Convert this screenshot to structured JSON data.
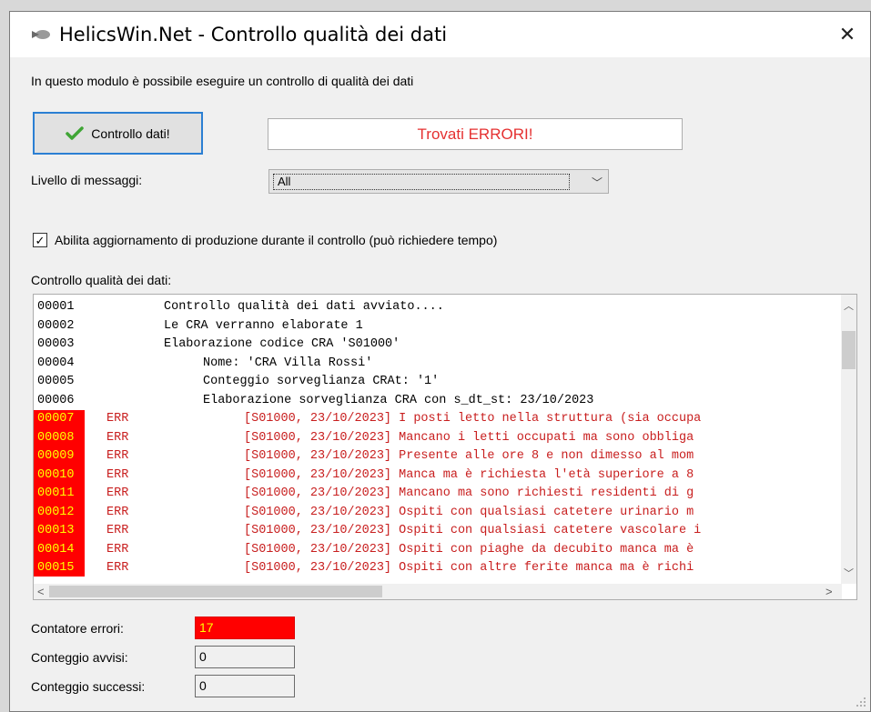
{
  "window": {
    "title": "HelicsWin.Net - Controllo qualità dei dati",
    "close_glyph": "✕"
  },
  "intro": "In questo modulo è possibile eseguire un controllo di qualità dei dati",
  "check_button": {
    "label": "Controllo dati!",
    "icon": "checkmark-icon"
  },
  "result_text": "Trovati ERRORI!",
  "message_level": {
    "label": "Livello di messaggi:",
    "value": "All"
  },
  "production_update": {
    "label": "Abilita aggiornamento di produzione durante il controllo (può richiedere tempo)",
    "checked": true
  },
  "log": {
    "label": "Controllo qualità dei dati:",
    "rows": [
      {
        "num": "00001",
        "level": "",
        "text": "Controllo qualità dei dati avviato....",
        "indent": 0
      },
      {
        "num": "00002",
        "level": "",
        "text": "Le CRA verranno elaborate 1",
        "indent": 0
      },
      {
        "num": "00003",
        "level": "",
        "text": "Elaborazione codice CRA 'S01000'",
        "indent": 0
      },
      {
        "num": "00004",
        "level": "",
        "text": "Nome: 'CRA Villa Rossi'",
        "indent": 1
      },
      {
        "num": "00005",
        "level": "",
        "text": "Conteggio sorveglianza CRAt: '1'",
        "indent": 1
      },
      {
        "num": "00006",
        "level": "",
        "text": "Elaborazione sorveglianza CRA con s_dt_st: 23/10/2023",
        "indent": 1
      },
      {
        "num": "00007",
        "level": "ERR",
        "text": "[S01000, 23/10/2023] I posti letto nella struttura (sia occupa",
        "indent": 2
      },
      {
        "num": "00008",
        "level": "ERR",
        "text": "[S01000, 23/10/2023] Mancano i letti occupati ma sono obbliga",
        "indent": 2
      },
      {
        "num": "00009",
        "level": "ERR",
        "text": "[S01000, 23/10/2023] Presente alle ore 8 e non dimesso al mom",
        "indent": 2
      },
      {
        "num": "00010",
        "level": "ERR",
        "text": "[S01000, 23/10/2023] Manca ma è richiesta l'età superiore a 8",
        "indent": 2
      },
      {
        "num": "00011",
        "level": "ERR",
        "text": "[S01000, 23/10/2023] Mancano ma sono richiesti residenti di g",
        "indent": 2
      },
      {
        "num": "00012",
        "level": "ERR",
        "text": "[S01000, 23/10/2023] Ospiti con qualsiasi catetere urinario m",
        "indent": 2
      },
      {
        "num": "00013",
        "level": "ERR",
        "text": "[S01000, 23/10/2023] Ospiti con qualsiasi catetere vascolare i",
        "indent": 2
      },
      {
        "num": "00014",
        "level": "ERR",
        "text": "[S01000, 23/10/2023] Ospiti con piaghe da decubito manca ma è",
        "indent": 2
      },
      {
        "num": "00015",
        "level": "ERR",
        "text": "[S01000, 23/10/2023] Ospiti con altre ferite manca ma è richi",
        "indent": 2
      }
    ]
  },
  "counters": {
    "errors": {
      "label": "Contatore errori:",
      "value": "17"
    },
    "warnings": {
      "label": "Conteggio avvisi:",
      "value": "0"
    },
    "successes": {
      "label": "Conteggio successi:",
      "value": "0"
    }
  },
  "colors": {
    "error_text": "#c81e1e",
    "error_bg": "#ff0000",
    "result_text": "#e53030",
    "focus_border": "#2b7fd3"
  }
}
